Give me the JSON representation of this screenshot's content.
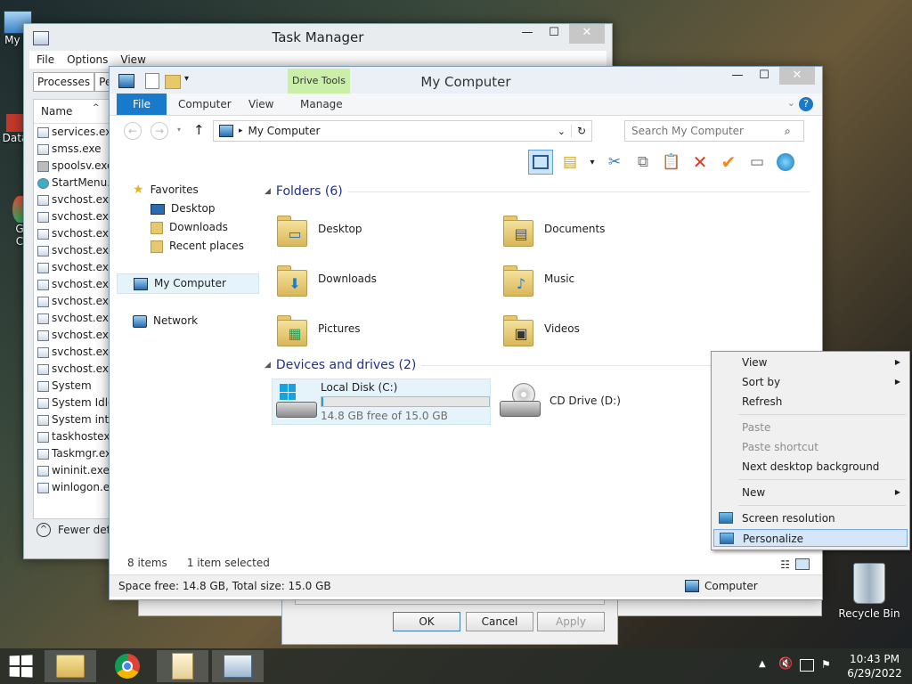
{
  "desktop": {
    "icons": [
      {
        "label": "My C"
      },
      {
        "label": "Data"
      },
      {
        "label": "G"
      },
      {
        "label": "C"
      }
    ],
    "recycle_bin": "Recycle Bin"
  },
  "task_manager": {
    "title": "Task Manager",
    "menu": [
      "File",
      "Options",
      "View"
    ],
    "tabs": [
      "Processes",
      "Per"
    ],
    "column_header": "Name",
    "processes": [
      "services.exe",
      "smss.exe",
      "spoolsv.exe",
      "StartMenu.ex",
      "svchost.exe",
      "svchost.exe",
      "svchost.exe",
      "svchost.exe",
      "svchost.exe",
      "svchost.exe",
      "svchost.exe",
      "svchost.exe",
      "svchost.exe",
      "svchost.exe",
      "svchost.exe",
      "System",
      "System Idle I",
      "System inter",
      "taskhostex.e",
      "Taskmgr.exe",
      "wininit.exe",
      "winlogon.ex"
    ],
    "fewer_details": "Fewer deta"
  },
  "dialog": {
    "ok": "OK",
    "cancel": "Cancel",
    "apply": "Apply"
  },
  "explorer": {
    "title": "My Computer",
    "ribbon_tabs": {
      "file": "File",
      "computer": "Computer",
      "view": "View",
      "manage": "Manage"
    },
    "drive_tools": "Drive Tools",
    "address": "My Computer",
    "search_placeholder": "Search My Computer",
    "nav": {
      "favorites": "Favorites",
      "desktop": "Desktop",
      "downloads": "Downloads",
      "recent": "Recent places",
      "my_computer": "My Computer",
      "network": "Network"
    },
    "folders_header": "Folders (6)",
    "folders": [
      "Desktop",
      "Documents",
      "Downloads",
      "Music",
      "Pictures",
      "Videos"
    ],
    "drives_header": "Devices and drives (2)",
    "drives": [
      {
        "name": "Local Disk (C:)",
        "free": "14.8 GB free of 15.0 GB",
        "used_fraction": 0.013
      },
      {
        "name": "CD Drive (D:)"
      }
    ],
    "status": {
      "items": "8 items",
      "selected": "1 item selected"
    },
    "details": {
      "space": "Space free: 14.8 GB, Total size: 15.0 GB",
      "computer": "Computer"
    }
  },
  "context_menu": {
    "view": "View",
    "sort_by": "Sort by",
    "refresh": "Refresh",
    "paste": "Paste",
    "paste_shortcut": "Paste shortcut",
    "next_bg": "Next desktop background",
    "new": "New",
    "screen_res": "Screen resolution",
    "personalize": "Personalize"
  },
  "taskbar": {
    "time": "10:43 PM",
    "date": "6/29/2022"
  },
  "colors": {
    "accent": "#1979ca",
    "drive_tools": "#c9efa8",
    "highlight": "#d5e6f8"
  }
}
